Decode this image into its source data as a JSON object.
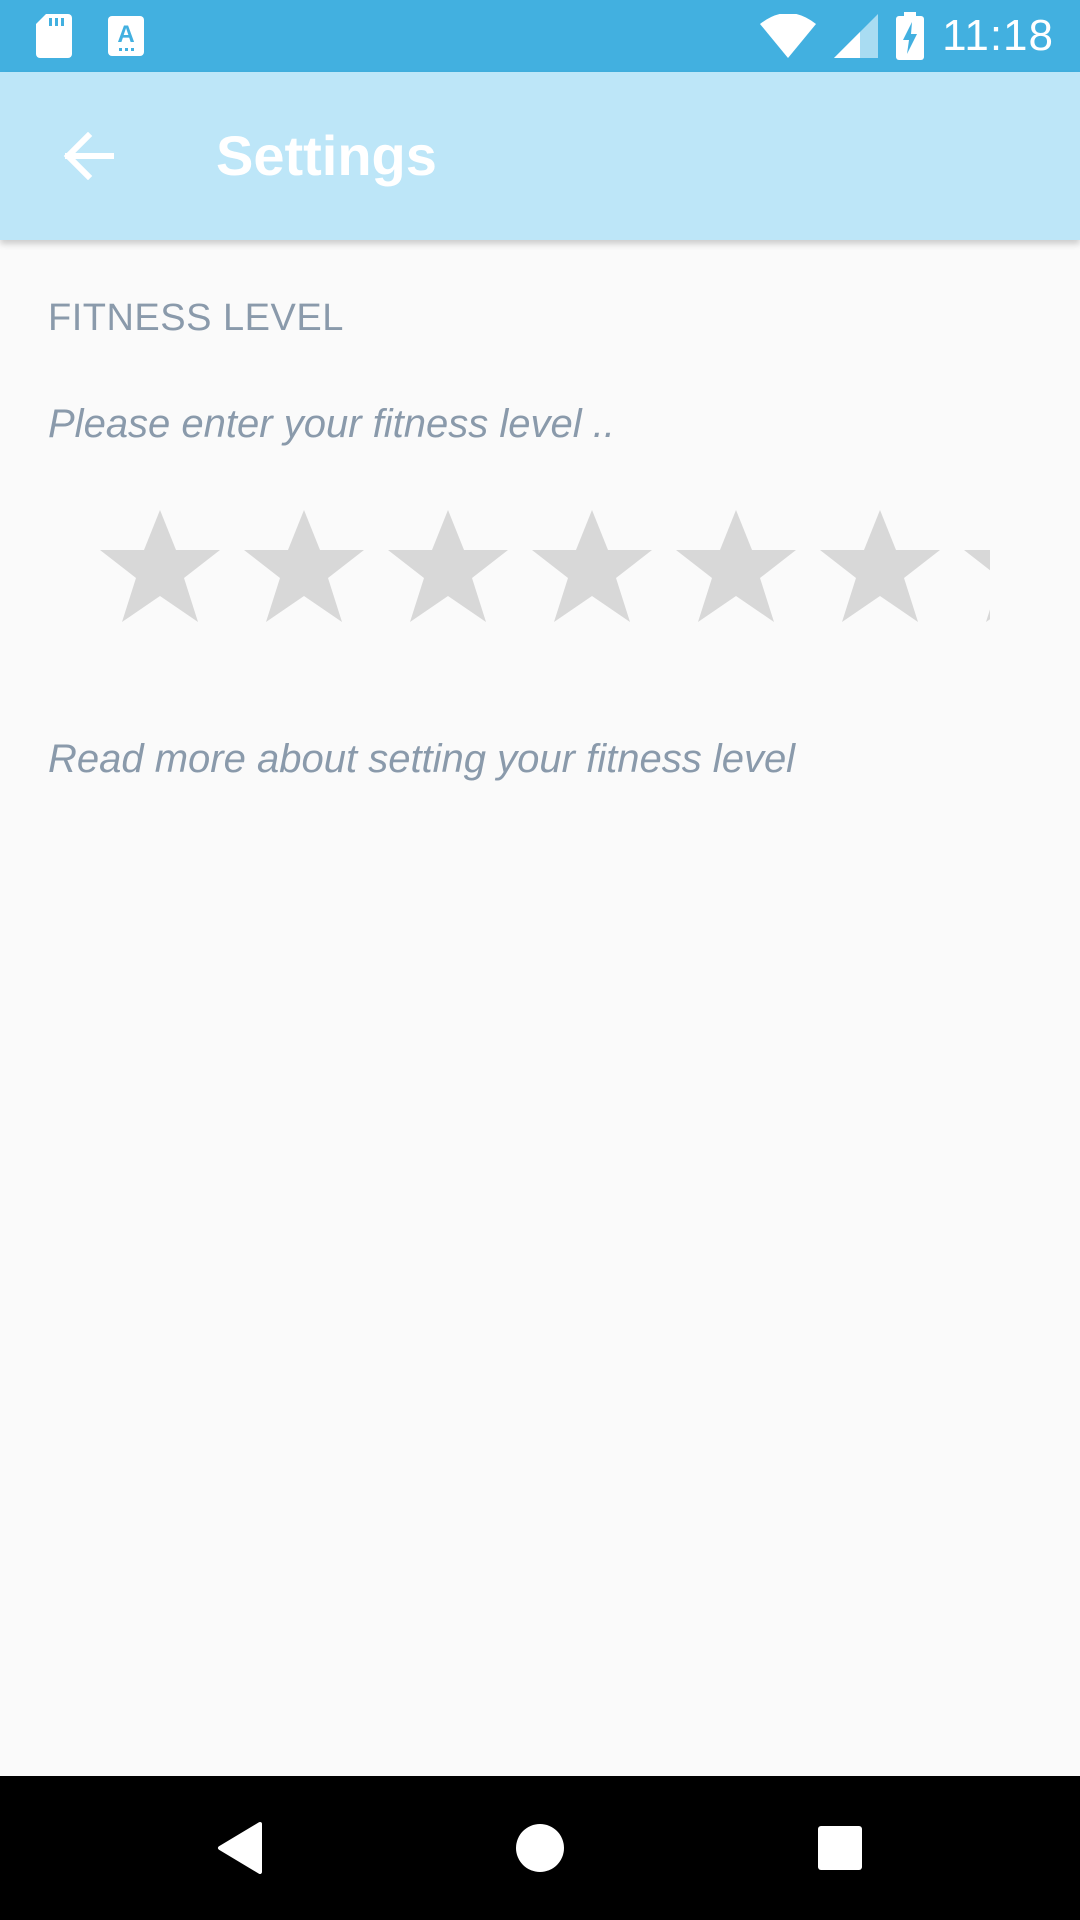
{
  "status_bar": {
    "time": "11:18",
    "left_icons": [
      "sd-card-icon",
      "keyboard-a-icon"
    ],
    "right_icons": [
      "wifi-icon",
      "signal-icon",
      "battery-charging-icon"
    ],
    "bg_color": "#42b0e0"
  },
  "app_bar": {
    "title": "Settings",
    "back_icon": "arrow-left-icon",
    "bg_color": "#bde6f8"
  },
  "fitness": {
    "section_header": "FITNESS LEVEL",
    "prompt": "Please enter your fitness level ..",
    "rating": {
      "value": 0,
      "visible_stars": 7,
      "star_color": "#d8d8d8"
    },
    "read_more_link": "Read more about setting your fitness level"
  },
  "nav_bar": {
    "icons": [
      "back-triangle-icon",
      "home-circle-icon",
      "recents-square-icon"
    ]
  }
}
